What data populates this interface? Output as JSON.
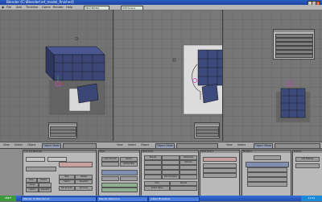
{
  "window": {
    "title": "Blender [C:\\Blender\\ref_model_finished]",
    "min": "_",
    "max": "□",
    "close": "x"
  },
  "menu": {
    "items": [
      "File",
      "Add",
      "Timeline",
      "Game",
      "Render",
      "Help"
    ],
    "screen": "SR:2-Model",
    "scene": "SCE:Scene"
  },
  "viewport_header": {
    "view": "View",
    "select": "Select",
    "object": "Object",
    "mode": "Object Mode"
  },
  "buttons": {
    "tab_link": "Link and Materials",
    "tab_mesh": "Mesh",
    "tab_modifiers": "Modifiers",
    "tab_tools": "Mesh Tools",
    "tab_mesh_tools": "Mesh Tools 1",
    "tab_multires": "Multires",
    "auto_smooth": "Auto Smooth",
    "set_smooth": "Set Smooth",
    "set_solid": "Set Solid",
    "subdivide": "Subdivide",
    "extrude": "Extrude",
    "beauty": "Beauty",
    "add_multires": "Add Multires",
    "centre": "Centre",
    "centre_new": "Centre New",
    "remove_doubles": "Rem Doubles",
    "hide": "Hide",
    "reveal": "Reveal",
    "select_swap": "Select Swap",
    "new": "New",
    "delete": "Delete",
    "assign": "Assign",
    "select": "Select",
    "deselect": "Deselect"
  },
  "taskbar": {
    "start": "start",
    "tasks": [
      "Blender [C:\\Blender\\ref...",
      "Blender Reference",
      "Adobe Photoshop"
    ],
    "clock": "12:41"
  }
}
